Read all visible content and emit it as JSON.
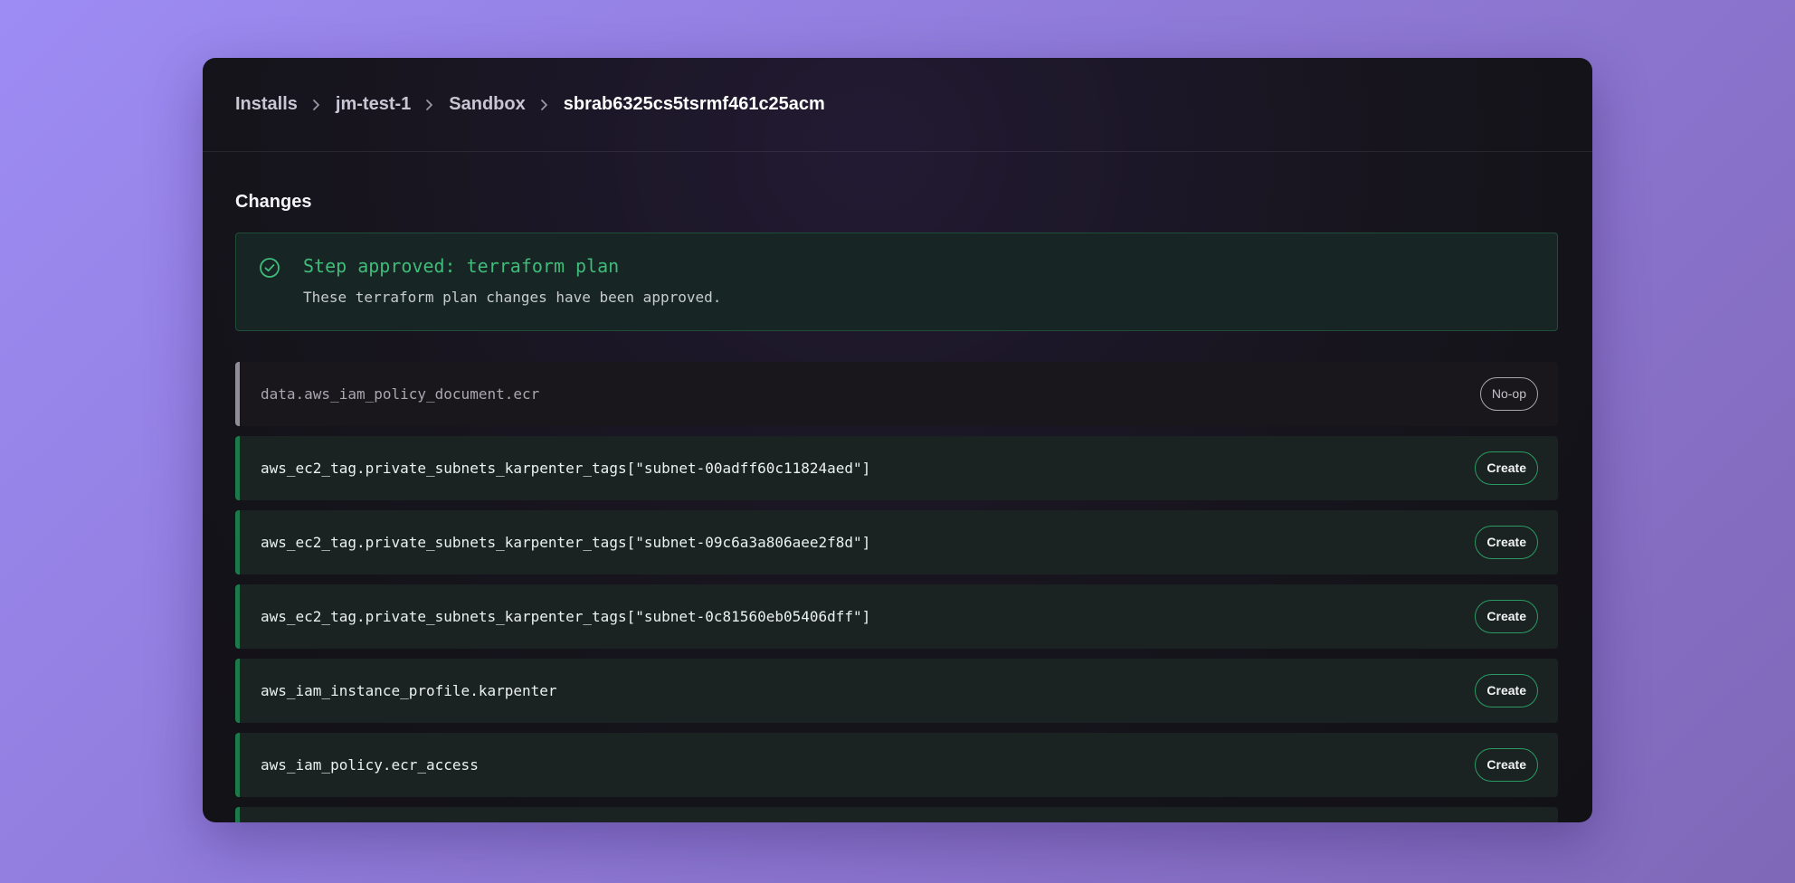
{
  "breadcrumb": [
    "Installs",
    "jm-test-1",
    "Sandbox",
    "sbrab6325cs5tsrmf461c25acm"
  ],
  "section_title": "Changes",
  "approval": {
    "title": "Step approved: terraform plan",
    "description": "These terraform plan changes have been approved."
  },
  "changes": [
    {
      "resource": "data.aws_iam_policy_document.ecr",
      "action": "No-op"
    },
    {
      "resource": "aws_ec2_tag.private_subnets_karpenter_tags[\"subnet-00adff60c11824aed\"]",
      "action": "Create"
    },
    {
      "resource": "aws_ec2_tag.private_subnets_karpenter_tags[\"subnet-09c6a3a806aee2f8d\"]",
      "action": "Create"
    },
    {
      "resource": "aws_ec2_tag.private_subnets_karpenter_tags[\"subnet-0c81560eb05406dff\"]",
      "action": "Create"
    },
    {
      "resource": "aws_iam_instance_profile.karpenter",
      "action": "Create"
    },
    {
      "resource": "aws_iam_policy.ecr_access",
      "action": "Create"
    }
  ],
  "colors": {
    "accent_green": "#3fbb7a",
    "create_border": "#1c7a4a",
    "noop_border": "#8f8d95"
  }
}
